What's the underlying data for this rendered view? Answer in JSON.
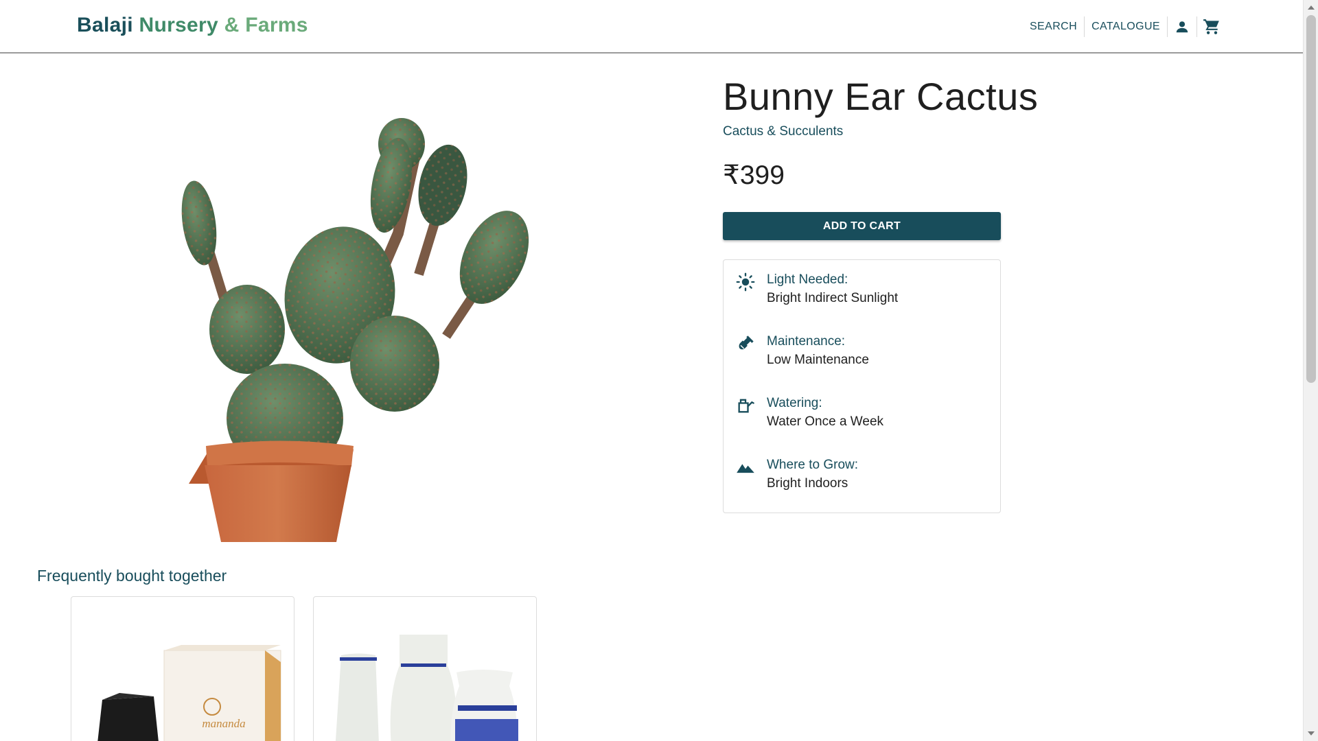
{
  "header": {
    "brand_part1": "Balaji",
    "brand_part2": "Nursery",
    "brand_part3": "& Farms",
    "nav": {
      "search_label": "SEARCH",
      "catalogue_label": "CATALOGUE",
      "account_icon": "person-icon",
      "cart_icon": "cart-icon"
    }
  },
  "product": {
    "title": "Bunny Ear Cactus",
    "category": "Cactus & Succulents",
    "price": "₹399",
    "add_to_cart_label": "ADD TO CART",
    "image": "cactus-in-terracotta-pot"
  },
  "care": [
    {
      "label": "Light Needed:",
      "value": "Bright Indirect Sunlight",
      "icon": "sun-icon"
    },
    {
      "label": "Maintenance:",
      "value": "Low Maintenance",
      "icon": "shovel-icon"
    },
    {
      "label": "Watering:",
      "value": "Water Once a Week",
      "icon": "watering-can-icon"
    },
    {
      "label": "Where to Grow:",
      "value": "Bright Indoors",
      "icon": "terrain-icon"
    }
  ],
  "frequently_bought": {
    "title": "Frequently bought together",
    "items": [
      {
        "image": "black-planter-with-box",
        "box_text": "mananda"
      },
      {
        "image": "white-blue-striped-vases"
      }
    ]
  },
  "colors": {
    "primary": "#184d5b",
    "brand_green": "#3f8a68",
    "brand_light_green": "#6aaa7a",
    "text": "#1f1f1f"
  }
}
